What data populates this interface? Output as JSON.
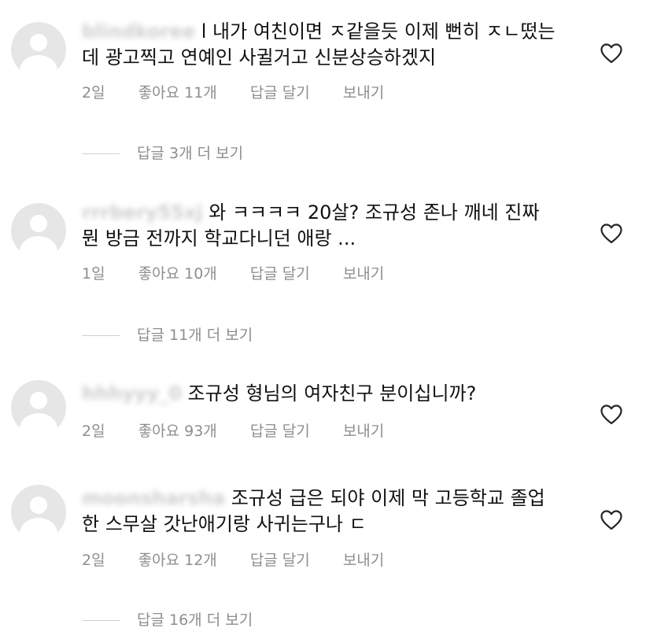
{
  "comments": [
    {
      "username": "blindkoree",
      "text": "l 내가 여친이면 ㅈ같을듯 이제 뻔히 ㅈㄴ떴는데 광고찍고 연예인 사귈거고 신분상승하겠지",
      "time": "2일",
      "likes": "좋아요 11개",
      "reply": "답글 달기",
      "send": "보내기",
      "more_replies": "답글 3개 더 보기"
    },
    {
      "username": "rrrbery55xj",
      "text": "와 ㅋㅋㅋㅋ 20살? 조규성 존나 깨네 진짜 뭔 방금 전까지 학교다니던 애랑 ...",
      "time": "1일",
      "likes": "좋아요 10개",
      "reply": "답글 달기",
      "send": "보내기",
      "more_replies": "답글 11개 더 보기"
    },
    {
      "username": "hhhyyy_0",
      "text": "조규성 형님의 여자친구 분이십니까?",
      "time": "2일",
      "likes": "좋아요 93개",
      "reply": "답글 달기",
      "send": "보내기",
      "more_replies": ""
    },
    {
      "username": "moonsharsha",
      "text": "조규성 급은 되야 이제 막 고등학교 졸업한 스무살 갓난애기랑 사귀는구나 ㄷ",
      "time": "2일",
      "likes": "좋아요 12개",
      "reply": "답글 달기",
      "send": "보내기",
      "more_replies": "답글 16개 더 보기"
    }
  ],
  "icons": {
    "like": "heart-outline-icon",
    "avatar": "default-avatar-icon"
  },
  "colors": {
    "text": "#111111",
    "meta": "#8e8e8e",
    "avatar_bg": "#e6e6e6"
  }
}
